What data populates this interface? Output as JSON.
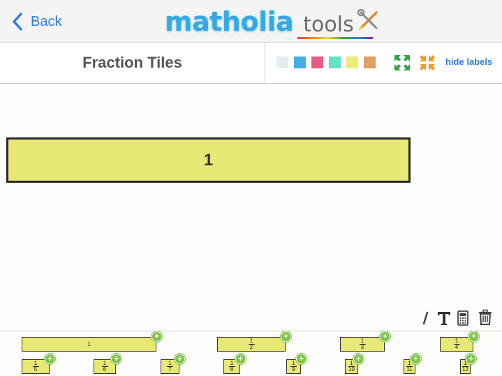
{
  "header": {
    "back_label": "Back",
    "logo_word": "matholia",
    "logo_suffix": "tools"
  },
  "toolbar": {
    "title": "Fraction Tiles",
    "swatches": [
      {
        "name": "white",
        "color": "#e7ecf1"
      },
      {
        "name": "blue",
        "color": "#46aee3"
      },
      {
        "name": "pink",
        "color": "#e55d83"
      },
      {
        "name": "teal",
        "color": "#62e3c4"
      },
      {
        "name": "yellow",
        "color": "#e9ec79"
      },
      {
        "name": "orange",
        "color": "#e0a062"
      }
    ],
    "expand_icon": "expand-arrows-icon",
    "collapse_icon": "collapse-arrows-icon",
    "hide_labels": "hide labels"
  },
  "canvas": {
    "main_tile_label": "1",
    "tile_color": "#e8e874",
    "edit_tools": [
      "pencil-icon",
      "text-icon",
      "calculator-icon",
      "trash-icon"
    ]
  },
  "palette": {
    "row1": [
      {
        "num": "1",
        "den": ""
      },
      {
        "num": "1",
        "den": "2"
      },
      {
        "num": "1",
        "den": "3"
      },
      {
        "num": "1",
        "den": "4"
      }
    ],
    "row2": [
      {
        "num": "1",
        "den": "5"
      },
      {
        "num": "1",
        "den": "6"
      },
      {
        "num": "1",
        "den": "7"
      },
      {
        "num": "1",
        "den": "8"
      },
      {
        "num": "1",
        "den": "9"
      },
      {
        "num": "1",
        "den": "10"
      },
      {
        "num": "1",
        "den": "11"
      },
      {
        "num": "1",
        "den": "12"
      }
    ],
    "add_symbol": "+"
  }
}
